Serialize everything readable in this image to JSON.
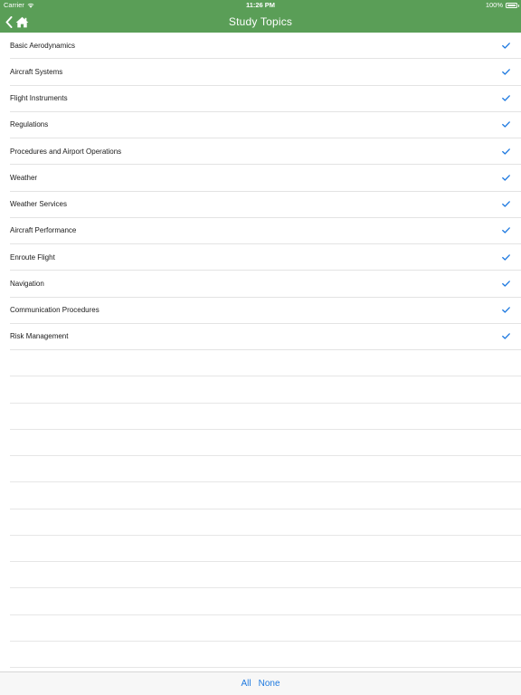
{
  "status_bar": {
    "carrier": "Carrier",
    "time": "11:26 PM",
    "battery": "100%"
  },
  "nav": {
    "title": "Study Topics",
    "back_icon": "chevron-left-icon",
    "home_icon": "home-icon"
  },
  "topics": [
    {
      "label": "Basic Aerodynamics",
      "checked": true
    },
    {
      "label": "Aircraft Systems",
      "checked": true
    },
    {
      "label": "Flight Instruments",
      "checked": true
    },
    {
      "label": "Regulations",
      "checked": true
    },
    {
      "label": "Procedures and Airport Operations",
      "checked": true
    },
    {
      "label": "Weather",
      "checked": true
    },
    {
      "label": "Weather Services",
      "checked": true
    },
    {
      "label": "Aircraft Performance",
      "checked": true
    },
    {
      "label": "Enroute Flight",
      "checked": true
    },
    {
      "label": "Navigation",
      "checked": true
    },
    {
      "label": "Communication Procedures",
      "checked": true
    },
    {
      "label": "Risk Management",
      "checked": true
    }
  ],
  "toolbar": {
    "all_label": "All",
    "none_label": "None"
  },
  "colors": {
    "nav_background": "#5a9e57",
    "accent": "#1f7ae0"
  }
}
